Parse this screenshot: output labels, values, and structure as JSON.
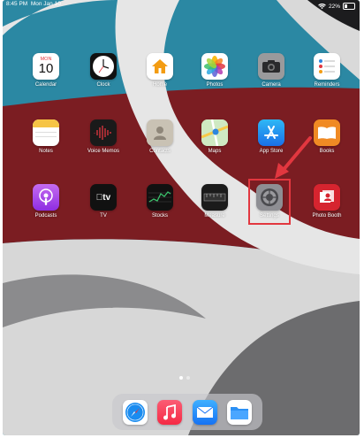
{
  "status": {
    "time": "8:45 PM",
    "date": "Mon Jan 10",
    "battery": "22%",
    "wifi": "wifi-icon"
  },
  "calendar": {
    "month": "MON",
    "day": "10"
  },
  "apps": [
    {
      "id": "calendar",
      "label": "Calendar"
    },
    {
      "id": "clock",
      "label": "Clock"
    },
    {
      "id": "home",
      "label": "Home"
    },
    {
      "id": "photos",
      "label": "Photos"
    },
    {
      "id": "camera",
      "label": "Camera"
    },
    {
      "id": "reminders",
      "label": "Reminders"
    },
    {
      "id": "notes",
      "label": "Notes"
    },
    {
      "id": "voice-memos",
      "label": "Voice Memos"
    },
    {
      "id": "contacts",
      "label": "Contacts"
    },
    {
      "id": "maps",
      "label": "Maps"
    },
    {
      "id": "app-store",
      "label": "App Store"
    },
    {
      "id": "books",
      "label": "Books"
    },
    {
      "id": "podcasts",
      "label": "Podcasts"
    },
    {
      "id": "tv",
      "label": "TV"
    },
    {
      "id": "stocks",
      "label": "Stocks"
    },
    {
      "id": "measure",
      "label": "Measure"
    },
    {
      "id": "settings",
      "label": "Settings"
    },
    {
      "id": "photo-booth",
      "label": "Photo Booth"
    }
  ],
  "dock": [
    "safari-icon",
    "music-icon",
    "mail-icon",
    "files-icon"
  ],
  "page_dots": {
    "count": 2,
    "active": 1
  },
  "annotation": {
    "color": "#e2373f"
  }
}
